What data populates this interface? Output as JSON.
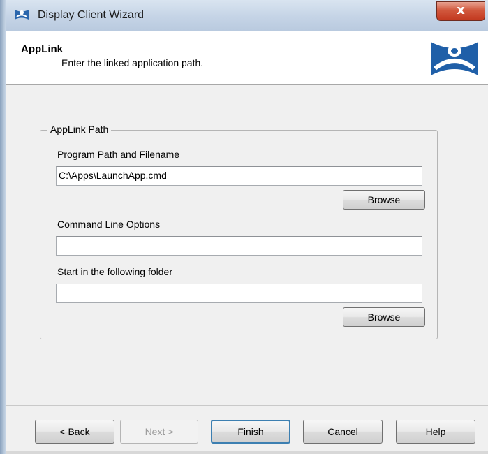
{
  "window": {
    "title": "Display Client Wizard",
    "close_label": "x"
  },
  "header": {
    "title": "AppLink",
    "subtitle": "Enter the linked application path."
  },
  "group": {
    "legend": "AppLink Path",
    "program_path_label": "Program Path and Filename",
    "program_path_value": "C:\\Apps\\LaunchApp.cmd",
    "browse_label_1": "Browse",
    "command_line_label": "Command Line Options",
    "command_line_value": "",
    "start_in_label": "Start in the following folder",
    "start_in_value": "",
    "browse_label_2": "Browse"
  },
  "footer": {
    "back_label": "< Back",
    "next_label": "Next >",
    "finish_label": "Finish",
    "cancel_label": "Cancel",
    "help_label": "Help"
  },
  "colors": {
    "accent": "#3c7fb1",
    "close_button": "#c2381f",
    "logo_blue": "#1f5fa8"
  },
  "icons": {
    "title_icon": "thinmanager-logo-icon",
    "header_logo": "thinmanager-logo-icon"
  }
}
